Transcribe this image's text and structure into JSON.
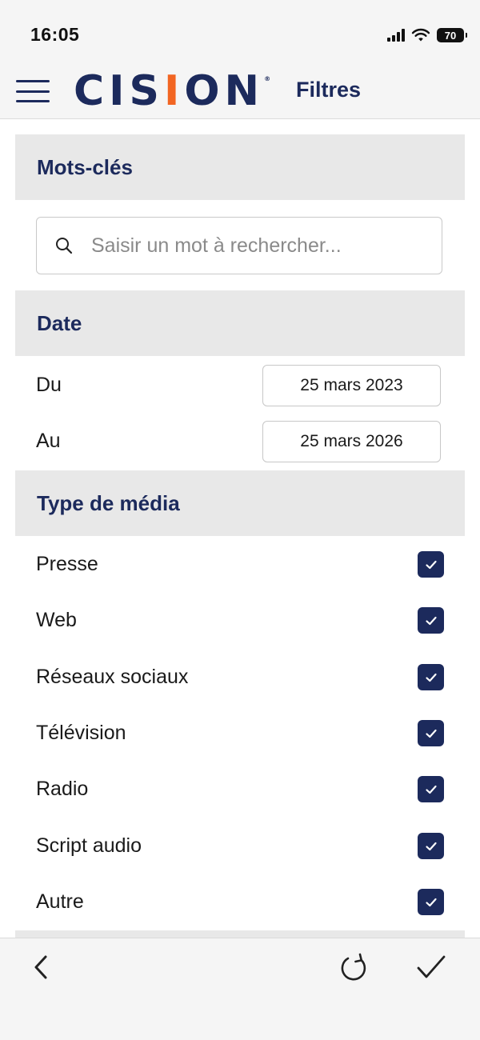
{
  "status_bar": {
    "time": "16:05",
    "battery": "70"
  },
  "header": {
    "logo_pre": "CIS",
    "logo_accent": "I",
    "logo_post": "ON",
    "logo_mark": "®",
    "title": "Filtres"
  },
  "keywords": {
    "title": "Mots-clés",
    "placeholder": "Saisir un mot à rechercher...",
    "value": ""
  },
  "date": {
    "title": "Date",
    "from_label": "Du",
    "from_value": "25 mars 2023",
    "to_label": "Au",
    "to_value": "25 mars 2026"
  },
  "media_type": {
    "title": "Type de média",
    "items": [
      {
        "label": "Presse",
        "checked": true
      },
      {
        "label": "Web",
        "checked": true
      },
      {
        "label": "Réseaux sociaux",
        "checked": true
      },
      {
        "label": "Télévision",
        "checked": true
      },
      {
        "label": "Radio",
        "checked": true
      },
      {
        "label": "Script audio",
        "checked": true
      },
      {
        "label": "Autre",
        "checked": true
      }
    ]
  },
  "icons": {
    "menu": "hamburger-icon",
    "search": "search-icon",
    "checkbox": "checkmark-icon",
    "back": "chevron-left-icon",
    "reset": "refresh-icon",
    "apply": "checkmark-icon"
  },
  "colors": {
    "brand_navy": "#1c2a5c",
    "brand_orange": "#f26522",
    "section_bg": "#e8e8e8"
  }
}
